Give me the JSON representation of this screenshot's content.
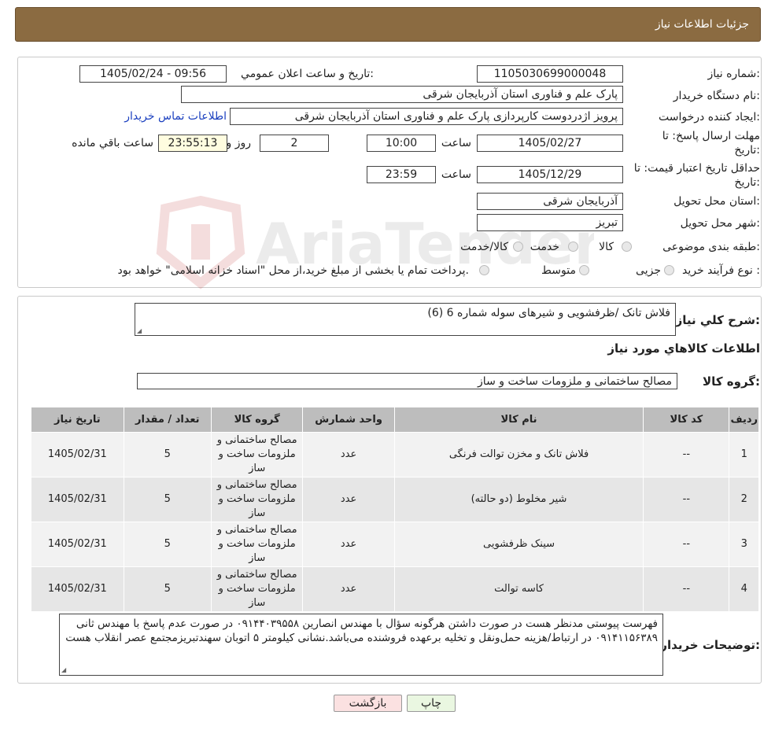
{
  "header": {
    "title": "جزئیات اطلاعات نیاز"
  },
  "fields": {
    "need_number_label": "شماره نیاز:",
    "need_number": "1105030699000048",
    "announce_label": "تاریخ و ساعت اعلان عمومي:",
    "announce_value": "1405/02/24 - 09:56",
    "buyer_label": "نام دستگاه خريدار:",
    "buyer_value": "پارک علم و فناوری استان آذربایجان شرقی",
    "creator_label": "ايجاد كننده درخواست:",
    "creator_value": "پرویز اژدردوست کارپردازی پارک علم و فناوری استان آذربایجان شرقی",
    "contact_link": "اطلاعات تماس خریدار",
    "deadline_label_1": "مهلت ارسال پاسخ: تا",
    "deadline_label_2": "تاریخ:",
    "deadline_date": "1405/02/27",
    "time_label": "ساعت",
    "deadline_time": "10:00",
    "days_value": "2",
    "days_label": "روز و",
    "remaining_time": "23:55:13",
    "remaining_label": "ساعت باقي مانده",
    "validity_label_1": "حداقل تاریخ اعتبار قیمت: تا",
    "validity_label_2": "تاریخ:",
    "validity_date": "1405/12/29",
    "validity_time_label": "ساعت",
    "validity_time": "23:59",
    "province_label": "استان محل تحویل:",
    "province_value": "آذربایجان شرقی",
    "city_label": "شهر محل تحویل:",
    "city_value": "تبریز",
    "category_label": "طبقه بندی موضوعی:",
    "category_options": [
      "کالا",
      "خدمت",
      "کالا/خدمت"
    ],
    "process_label": "نوع فرآیند خرید :",
    "process_options": [
      "جزیی",
      "متوسط"
    ],
    "process_note": "پرداخت تمام یا بخشی از مبلغ خرید،از محل \"اسناد خزانه اسلامی\" خواهد بود."
  },
  "summary": {
    "desc_label": "شرح كلي نياز:",
    "desc_value": "فلاش تانک /ظرفشویی و شیرهای سوله شماره 6 (6)",
    "goods_info_title": "اطلاعات كالاهاي مورد نياز",
    "goods_group_label": "گروه کالا:",
    "goods_group_value": "مصالح ساختمانی و ملزومات ساخت و ساز"
  },
  "table": {
    "headers": [
      "رديف",
      "كد كالا",
      "نام كالا",
      "واحد شمارش",
      "گروه كالا",
      "تعداد / مقدار",
      "تاريخ نياز"
    ],
    "rows": [
      {
        "idx": "1",
        "code": "--",
        "name": "فلاش تانک و مخزن توالت فرنگی",
        "unit": "عدد",
        "group": "مصالح ساختمانی و ملزومات ساخت و ساز",
        "qty": "5",
        "date": "1405/02/31"
      },
      {
        "idx": "2",
        "code": "--",
        "name": "شیر مخلوط (دو حالته)",
        "unit": "عدد",
        "group": "مصالح ساختمانی و ملزومات ساخت و ساز",
        "qty": "5",
        "date": "1405/02/31"
      },
      {
        "idx": "3",
        "code": "--",
        "name": "سینک ظرفشویی",
        "unit": "عدد",
        "group": "مصالح ساختمانی و ملزومات ساخت و ساز",
        "qty": "5",
        "date": "1405/02/31"
      },
      {
        "idx": "4",
        "code": "--",
        "name": "کاسه توالت",
        "unit": "عدد",
        "group": "مصالح ساختمانی و ملزومات ساخت و ساز",
        "qty": "5",
        "date": "1405/02/31"
      }
    ]
  },
  "notes": {
    "label": "توضیحات خریدار:",
    "text": "فهرست پیوستی مدنظر هست در صورت داشتن هرگونه سؤال با مهندس انصارین ۰۹۱۴۴۰۳۹۵۵۸ در صورت عدم پاسخ با مهندس ثانی ۰۹۱۴۱۱۵۶۳۸۹ در ارتباط/هزینه حمل‌ونقل و تخلیه برعهده فروشنده می‌باشد.نشانی کیلومتر ۵ اتوبان سهندتبریزمجتمع عصر انقلاب هست"
  },
  "buttons": {
    "print": "چاپ",
    "back": "بازگشت"
  },
  "watermark": {
    "text": "AriaTender.neT"
  },
  "colors": {
    "header_bg": "#8b6b41",
    "back_btn_bg": "#fbe1e1",
    "print_btn_bg": "#eaf7e1"
  }
}
